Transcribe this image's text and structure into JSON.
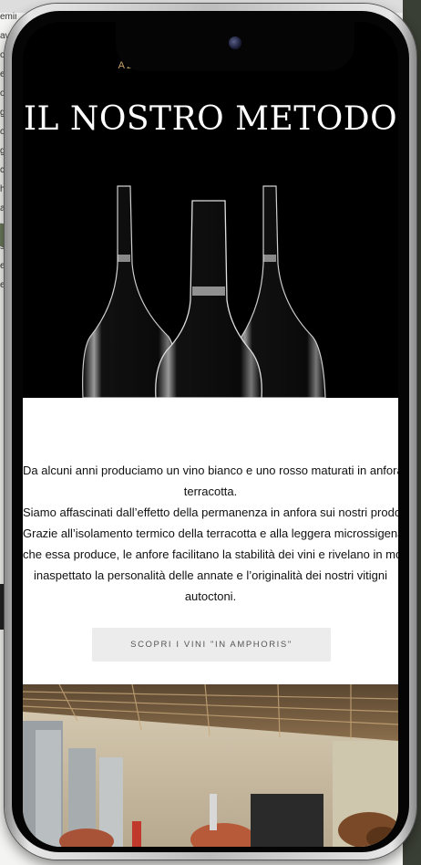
{
  "background_text": [
    "eminat",
    "ave",
    "o",
    "e",
    "o",
    "g",
    "o",
    "g",
    "c",
    "h",
    "a",
    "h",
    "s",
    "e",
    "e"
  ],
  "header": {
    "brand": "AZIENDA AGRICOLA RONCHI",
    "title": "IL NOSTRO METODO"
  },
  "intro": {
    "lines": [
      "Da alcuni anni produciamo un vino bianco e uno rosso maturati in anfora di",
      "terracotta.",
      "Siamo affascinati dall’effetto della permanenza in anfora sui nostri prodotti.",
      "Grazie all’isolamento termico della terracotta e alla leggera microssigenazione",
      "che essa produce, le anfore facilitano la stabilità dei vini e rivelano in modo",
      "inaspettato la personalità delle annate e l’originalità dei nostri vitigni",
      "autoctoni."
    ]
  },
  "cta": {
    "label": "SCOPRI I VINI \"IN AMPHORIS\""
  },
  "colors": {
    "brand_gold": "#c9a36a",
    "hero_bg": "#000000",
    "cta_bg": "#ececec"
  },
  "icons": {
    "camera": "front-camera-icon"
  }
}
